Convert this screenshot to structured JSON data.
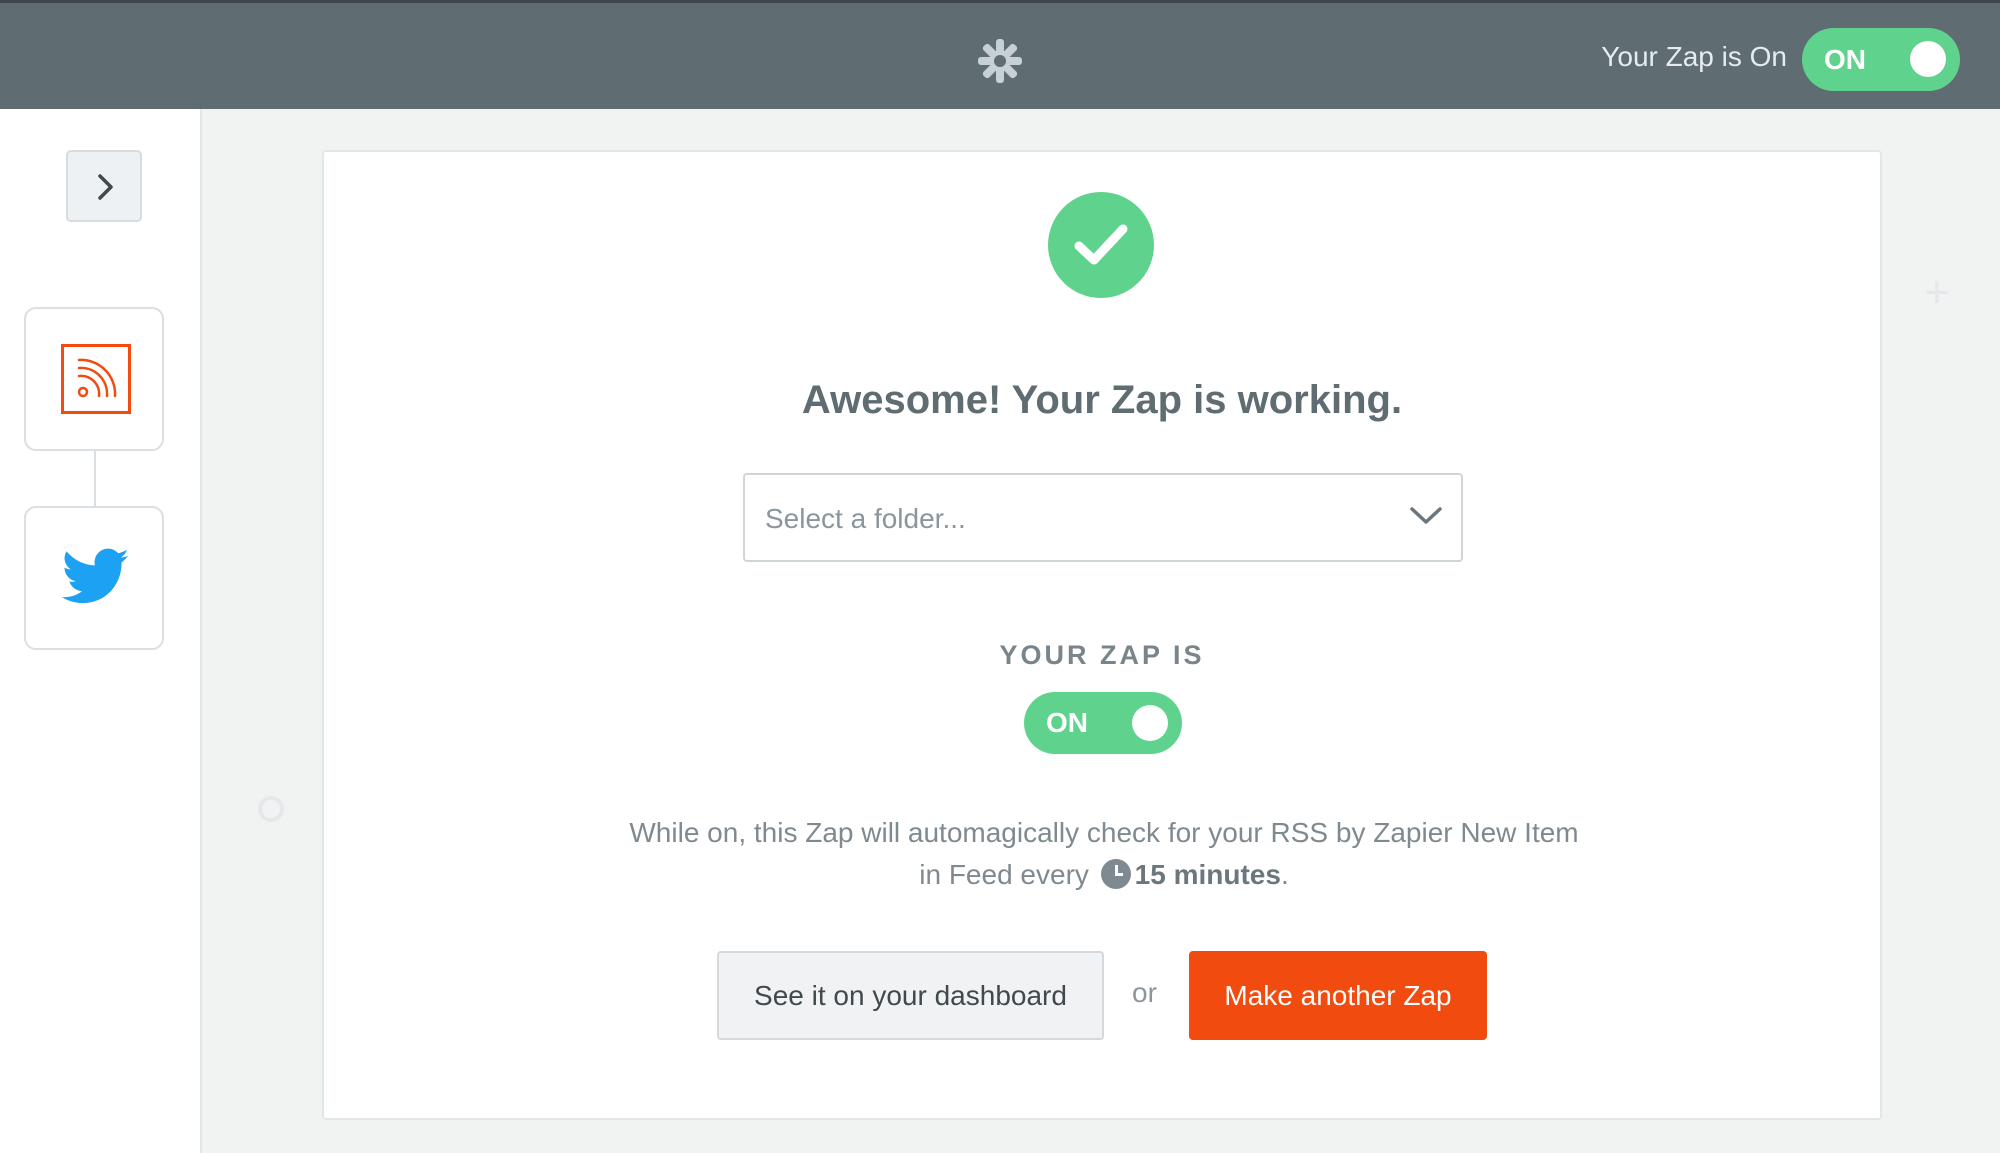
{
  "header": {
    "status_text": "Your Zap is On",
    "toggle_label": "ON",
    "logo_icon": "zapier-asterisk-icon"
  },
  "sidebar": {
    "expand_icon": "chevron-right-icon",
    "steps": [
      {
        "app": "RSS by Zapier",
        "icon": "rss-icon",
        "color": "#f24b0f"
      },
      {
        "app": "Twitter",
        "icon": "twitter-bird-icon",
        "color": "#1da1f2"
      }
    ]
  },
  "main": {
    "success_icon": "check-circle-icon",
    "heading": "Awesome! Your Zap is working.",
    "folder_select": {
      "placeholder": "Select a folder..."
    },
    "zap_status_label": "YOUR ZAP IS",
    "zap_toggle_label": "ON",
    "description_prefix": "While on, this Zap will automagically check for your RSS by Zapier New Item in Feed every",
    "description_interval": "15 minutes",
    "description_suffix": ".",
    "dashboard_button": "See it on your dashboard",
    "or_text": "or",
    "make_button": "Make another Zap"
  },
  "colors": {
    "topbar": "#5f6c72",
    "toggle_green": "#5fd38d",
    "accent_orange": "#f24b0f",
    "twitter_blue": "#1da1f2"
  }
}
